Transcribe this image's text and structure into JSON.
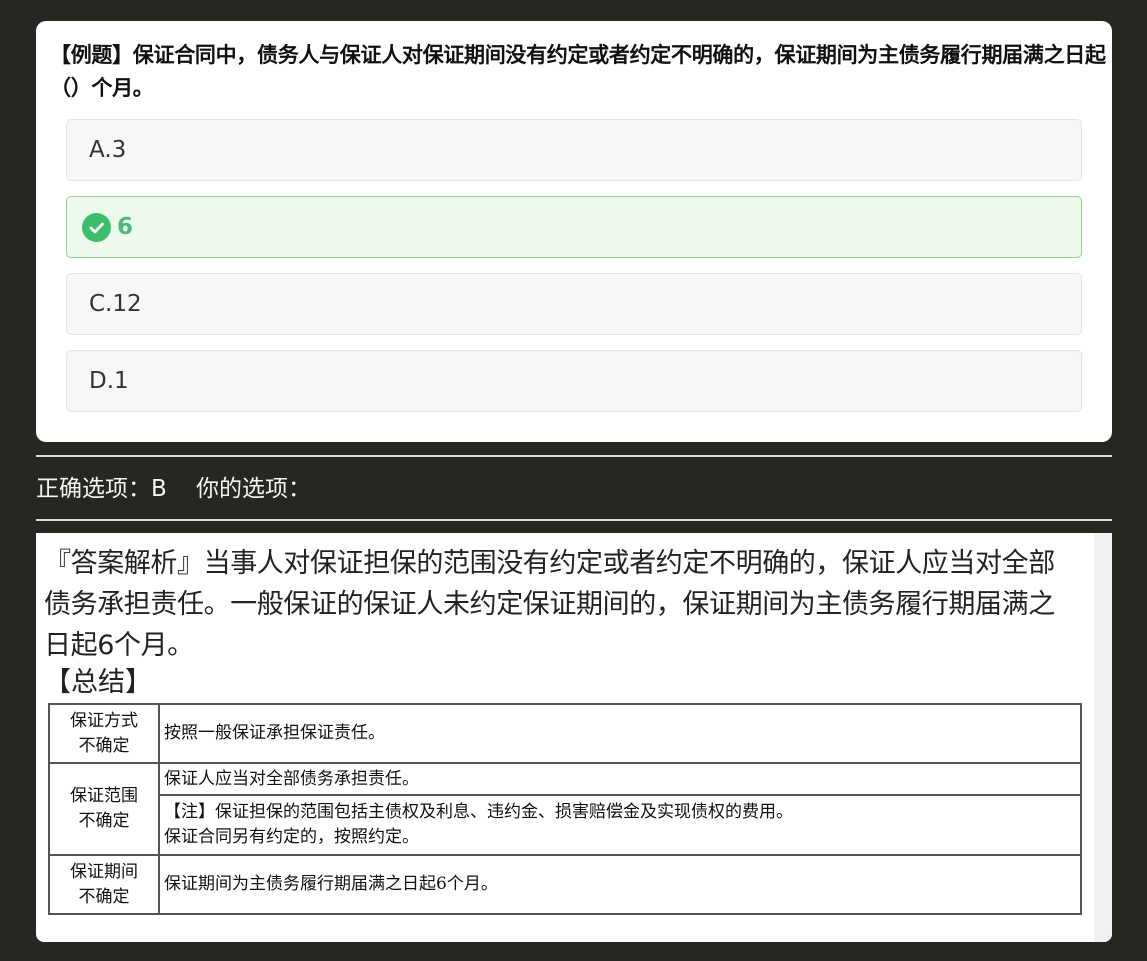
{
  "question": {
    "text": "【例题】保证合同中，债务人与保证人对保证期间没有约定或者约定不明确的，保证期间为主债务履行期届满之日起（）个月。",
    "options": [
      {
        "label": "A.3",
        "correct": false
      },
      {
        "label": "6",
        "correct": true,
        "icon": "check-circle-icon"
      },
      {
        "label": "C.12",
        "correct": false
      },
      {
        "label": "D.1",
        "correct": false
      }
    ]
  },
  "answer": {
    "correct_label": "正确选项：B",
    "your_label": "你的选项："
  },
  "analysis": {
    "text": "『答案解析』当事人对保证担保的范围没有约定或者约定不明确的，保证人应当对全部债务承担责任。一般保证的保证人未约定保证期间的，保证期间为主债务履行期届满之日起6个月。",
    "summary_heading": "【总结】",
    "table": {
      "rows": [
        {
          "head": [
            "保证方式",
            "不确定"
          ],
          "content": [
            "按照一般保证承担保证责任。"
          ]
        },
        {
          "head": [
            "保证范围",
            "不确定"
          ],
          "content": [
            "保证人应当对全部债务承担责任。"
          ]
        },
        {
          "content": [
            "【注】保证担保的范围包括主债权及利息、违约金、损害赔偿金及实现债权的费用。",
            "保证合同另有约定的，按照约定。"
          ]
        },
        {
          "head": [
            "保证期间",
            "不确定"
          ],
          "content": [
            "保证期间为主债务履行期届满之日起6个月。"
          ]
        }
      ]
    }
  },
  "colors": {
    "page_background": "#272722",
    "correct_green": "#3cbf6a",
    "correct_text": "#4cbb78",
    "correct_bg": "#eef9ee"
  }
}
